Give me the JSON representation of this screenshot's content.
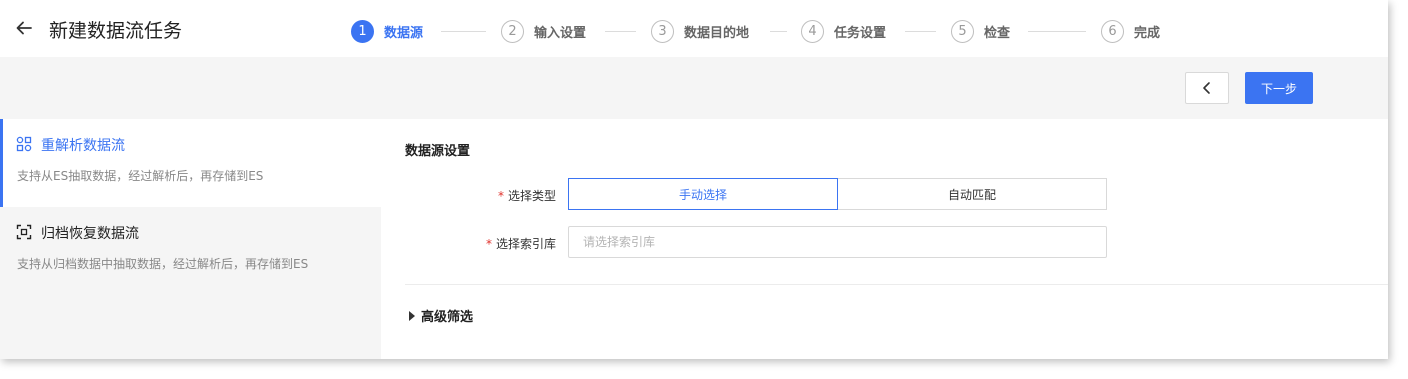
{
  "header": {
    "title": "新建数据流任务",
    "back_icon": "arrow-left-icon"
  },
  "steps": [
    {
      "num": "1",
      "label": "数据源",
      "active": true
    },
    {
      "num": "2",
      "label": "输入设置",
      "active": false
    },
    {
      "num": "3",
      "label": "数据目的地",
      "active": false
    },
    {
      "num": "4",
      "label": "任务设置",
      "active": false
    },
    {
      "num": "5",
      "label": "检查",
      "active": false
    },
    {
      "num": "6",
      "label": "完成",
      "active": false
    }
  ],
  "nav": {
    "prev_icon": "chevron-left-icon",
    "next_label": "下一步"
  },
  "sources": [
    {
      "title": "重解析数据流",
      "desc": "支持从ES抽取数据，经过解析后，再存储到ES",
      "icon": "nodes-icon",
      "selected": true
    },
    {
      "title": "归档恢复数据流",
      "desc": "支持从归档数据中抽取数据，经过解析后，再存储到ES",
      "icon": "scan-frame-icon",
      "selected": false
    }
  ],
  "form": {
    "section_title": "数据源设置",
    "type_label": "选择类型",
    "type_options": [
      "手动选择",
      "自动匹配"
    ],
    "type_selected": "手动选择",
    "index_label": "选择索引库",
    "index_placeholder": "请选择索引库",
    "index_value": "",
    "required_mark": "*",
    "advanced_label": "高级筛选"
  },
  "colors": {
    "accent": "#3b74f2",
    "required": "#e0322c"
  }
}
